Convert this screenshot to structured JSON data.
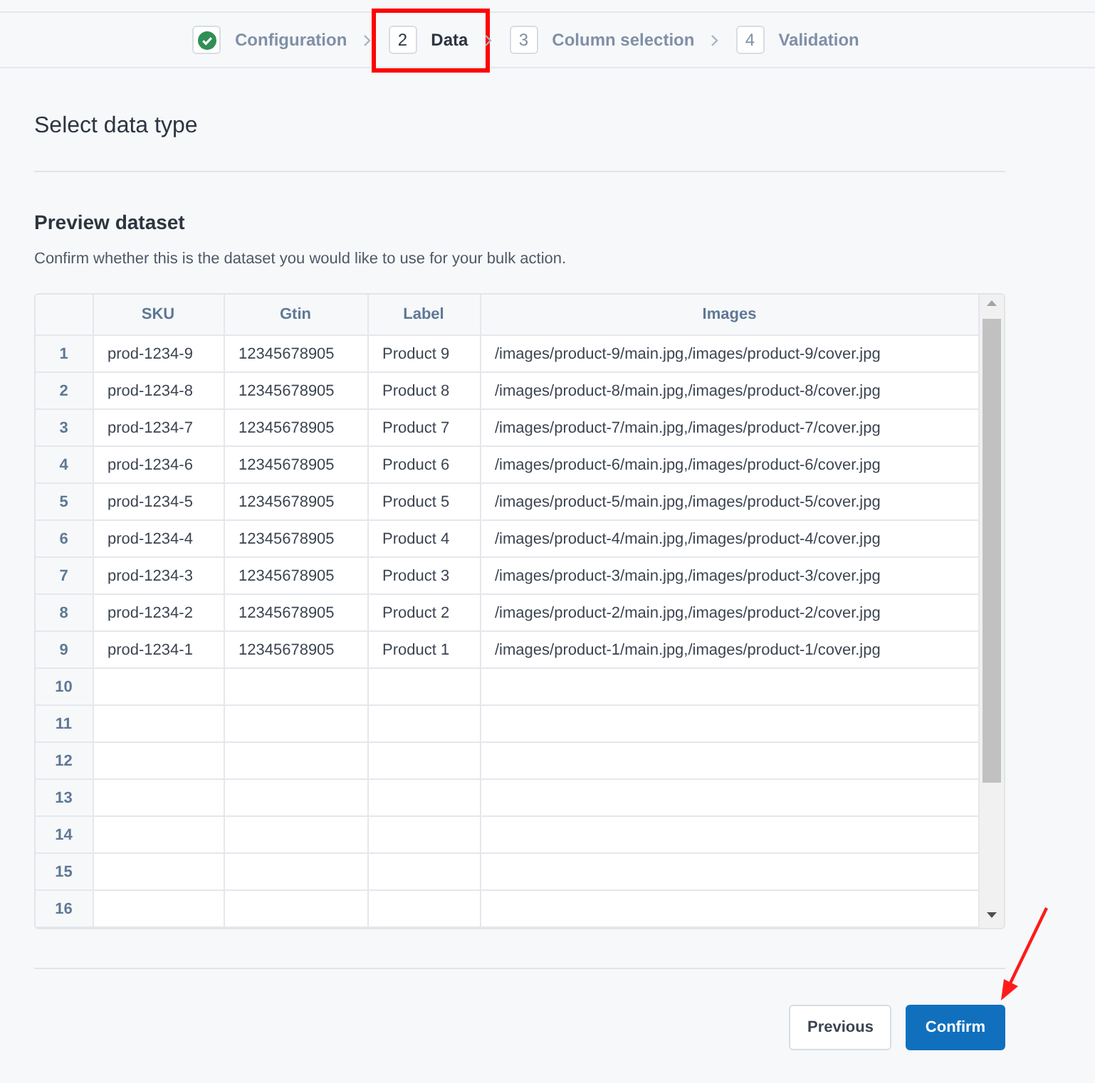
{
  "steps": [
    {
      "label": "Configuration",
      "completed": true,
      "selected": false,
      "highlighted": false
    },
    {
      "number": "2",
      "label": "Data",
      "completed": false,
      "selected": true,
      "highlighted": true
    },
    {
      "number": "3",
      "label": "Column selection",
      "completed": false,
      "selected": false,
      "highlighted": false
    },
    {
      "number": "4",
      "label": "Validation",
      "completed": false,
      "selected": false,
      "highlighted": false
    }
  ],
  "section_title": "Select data type",
  "preview": {
    "title": "Preview dataset",
    "description": "Confirm whether this is the dataset you would like to use for your bulk action."
  },
  "table": {
    "columns": [
      "SKU",
      "Gtin",
      "Label",
      "Images"
    ],
    "rows": [
      {
        "index": "1",
        "cells": [
          "prod-1234-9",
          "12345678905",
          "Product 9",
          "/images/product-9/main.jpg,/images/product-9/cover.jpg"
        ]
      },
      {
        "index": "2",
        "cells": [
          "prod-1234-8",
          "12345678905",
          "Product 8",
          "/images/product-8/main.jpg,/images/product-8/cover.jpg"
        ]
      },
      {
        "index": "3",
        "cells": [
          "prod-1234-7",
          "12345678905",
          "Product 7",
          "/images/product-7/main.jpg,/images/product-7/cover.jpg"
        ]
      },
      {
        "index": "4",
        "cells": [
          "prod-1234-6",
          "12345678905",
          "Product 6",
          "/images/product-6/main.jpg,/images/product-6/cover.jpg"
        ]
      },
      {
        "index": "5",
        "cells": [
          "prod-1234-5",
          "12345678905",
          "Product 5",
          "/images/product-5/main.jpg,/images/product-5/cover.jpg"
        ]
      },
      {
        "index": "6",
        "cells": [
          "prod-1234-4",
          "12345678905",
          "Product 4",
          "/images/product-4/main.jpg,/images/product-4/cover.jpg"
        ]
      },
      {
        "index": "7",
        "cells": [
          "prod-1234-3",
          "12345678905",
          "Product 3",
          "/images/product-3/main.jpg,/images/product-3/cover.jpg"
        ]
      },
      {
        "index": "8",
        "cells": [
          "prod-1234-2",
          "12345678905",
          "Product 2",
          "/images/product-2/main.jpg,/images/product-2/cover.jpg"
        ]
      },
      {
        "index": "9",
        "cells": [
          "prod-1234-1",
          "12345678905",
          "Product 1",
          "/images/product-1/main.jpg,/images/product-1/cover.jpg"
        ]
      },
      {
        "index": "10"
      },
      {
        "index": "11"
      },
      {
        "index": "12"
      },
      {
        "index": "13"
      },
      {
        "index": "14"
      },
      {
        "index": "15"
      },
      {
        "index": "16"
      }
    ]
  },
  "buttons": [
    {
      "label": "Previous",
      "kind": "secondary"
    },
    {
      "label": "Confirm",
      "kind": "primary"
    }
  ]
}
